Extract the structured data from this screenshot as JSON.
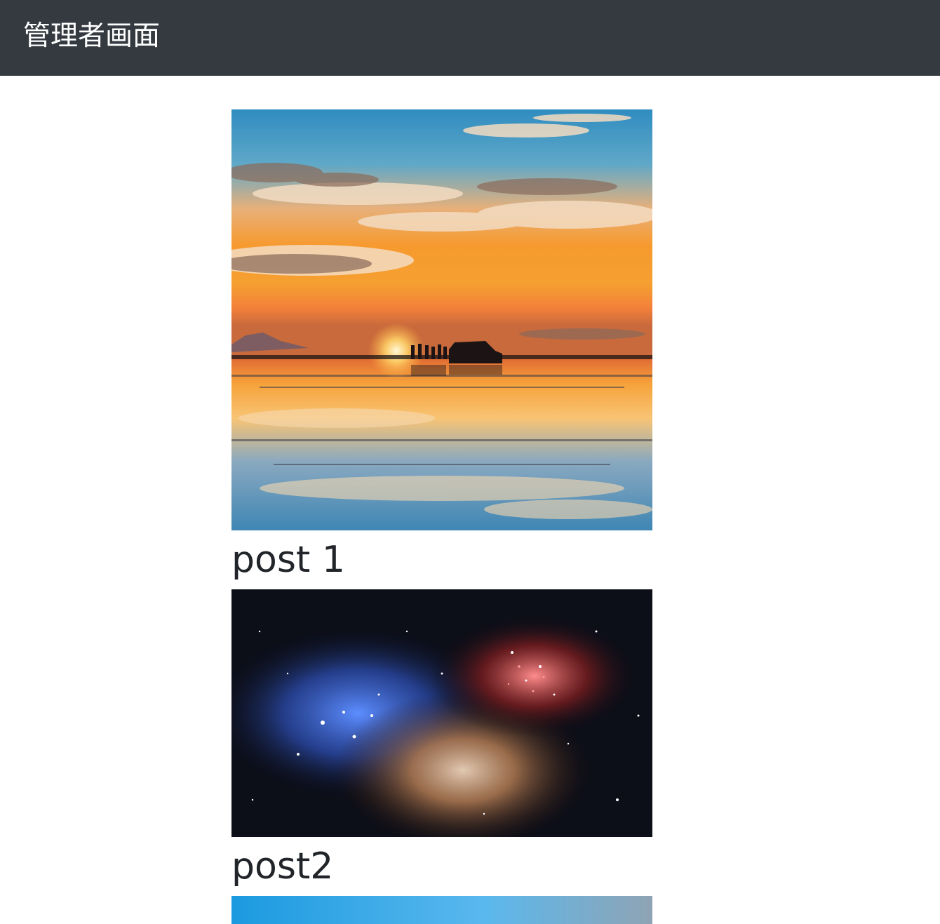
{
  "navbar": {
    "brand": "管理者画面"
  },
  "posts": [
    {
      "title": "post 1",
      "image": "sunset-salt-flat-reflection-photo"
    },
    {
      "title": "post2",
      "image": "star-cluster-nebula-photo"
    },
    {
      "title": "",
      "image": "sky-photo"
    }
  ],
  "colors": {
    "navbar_bg": "#343a40",
    "brand_text": "#ffffff",
    "title_text": "#212529"
  }
}
